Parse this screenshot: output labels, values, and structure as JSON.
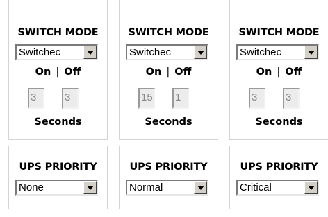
{
  "panels": [
    {
      "switch_mode": {
        "heading": "SWITCH MODE",
        "select_value": "Switchec",
        "on_label": "On",
        "separator": "|",
        "off_label": "Off",
        "on_value": "3",
        "off_value": "3",
        "unit_label": "Seconds"
      },
      "ups_priority": {
        "heading": "UPS PRIORITY",
        "select_value": "None"
      }
    },
    {
      "switch_mode": {
        "heading": "SWITCH MODE",
        "select_value": "Switchec",
        "on_label": "On",
        "separator": "|",
        "off_label": "Off",
        "on_value": "15",
        "off_value": "1",
        "unit_label": "Seconds"
      },
      "ups_priority": {
        "heading": "UPS PRIORITY",
        "select_value": "Normal"
      }
    },
    {
      "switch_mode": {
        "heading": "SWITCH MODE",
        "select_value": "Switchec",
        "on_label": "On",
        "separator": "|",
        "off_label": "Off",
        "on_value": "3",
        "off_value": "3",
        "unit_label": "Seconds"
      },
      "ups_priority": {
        "heading": "UPS PRIORITY",
        "select_value": "Critical"
      }
    }
  ],
  "icons": {
    "dropdown": "chevron-down-icon"
  },
  "colors": {
    "panel_border": "#d4d4d4",
    "disabled_field_bg": "#ececec",
    "disabled_text": "#8a8a8a"
  }
}
